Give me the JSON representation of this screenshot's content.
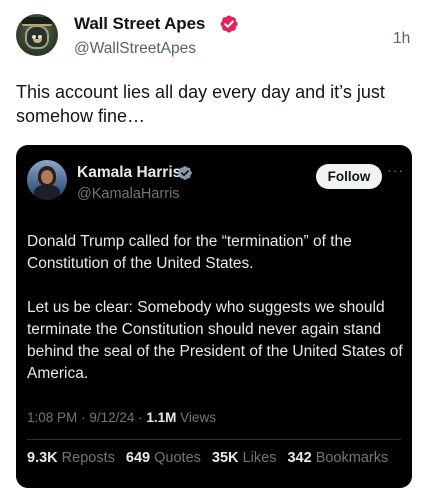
{
  "post": {
    "author_name": "Wall Street Apes",
    "author_handle": "@WallStreetApes",
    "time_ago": "1h",
    "text": "This account lies all day every day and it’s just somehow fine…",
    "badge_color": "#e0245e",
    "avatar_icon": "ape-avatar"
  },
  "quote": {
    "author_name": "Kamala Harris",
    "author_handle": "@KamalaHarris",
    "follow_label": "Follow",
    "more_label": "···",
    "badge_color": "#829aab",
    "avatar_icon": "portrait-avatar",
    "paragraph_1": "Donald Trump called for the “termination” of the Constitution of the United States.",
    "paragraph_2": "Let us be clear: Somebody who suggests we should terminate the Constitution should never again stand behind the seal of the President of the United States of America.",
    "time": "1:08 PM",
    "date": "9/12/24",
    "views_count": "1.1M",
    "views_label": "Views",
    "separator": "·",
    "stats": {
      "reposts_count": "9.3K",
      "reposts_label": "Reposts",
      "quotes_count": "649",
      "quotes_label": "Quotes",
      "likes_count": "35K",
      "likes_label": "Likes",
      "bookmarks_count": "342",
      "bookmarks_label": "Bookmarks"
    }
  }
}
